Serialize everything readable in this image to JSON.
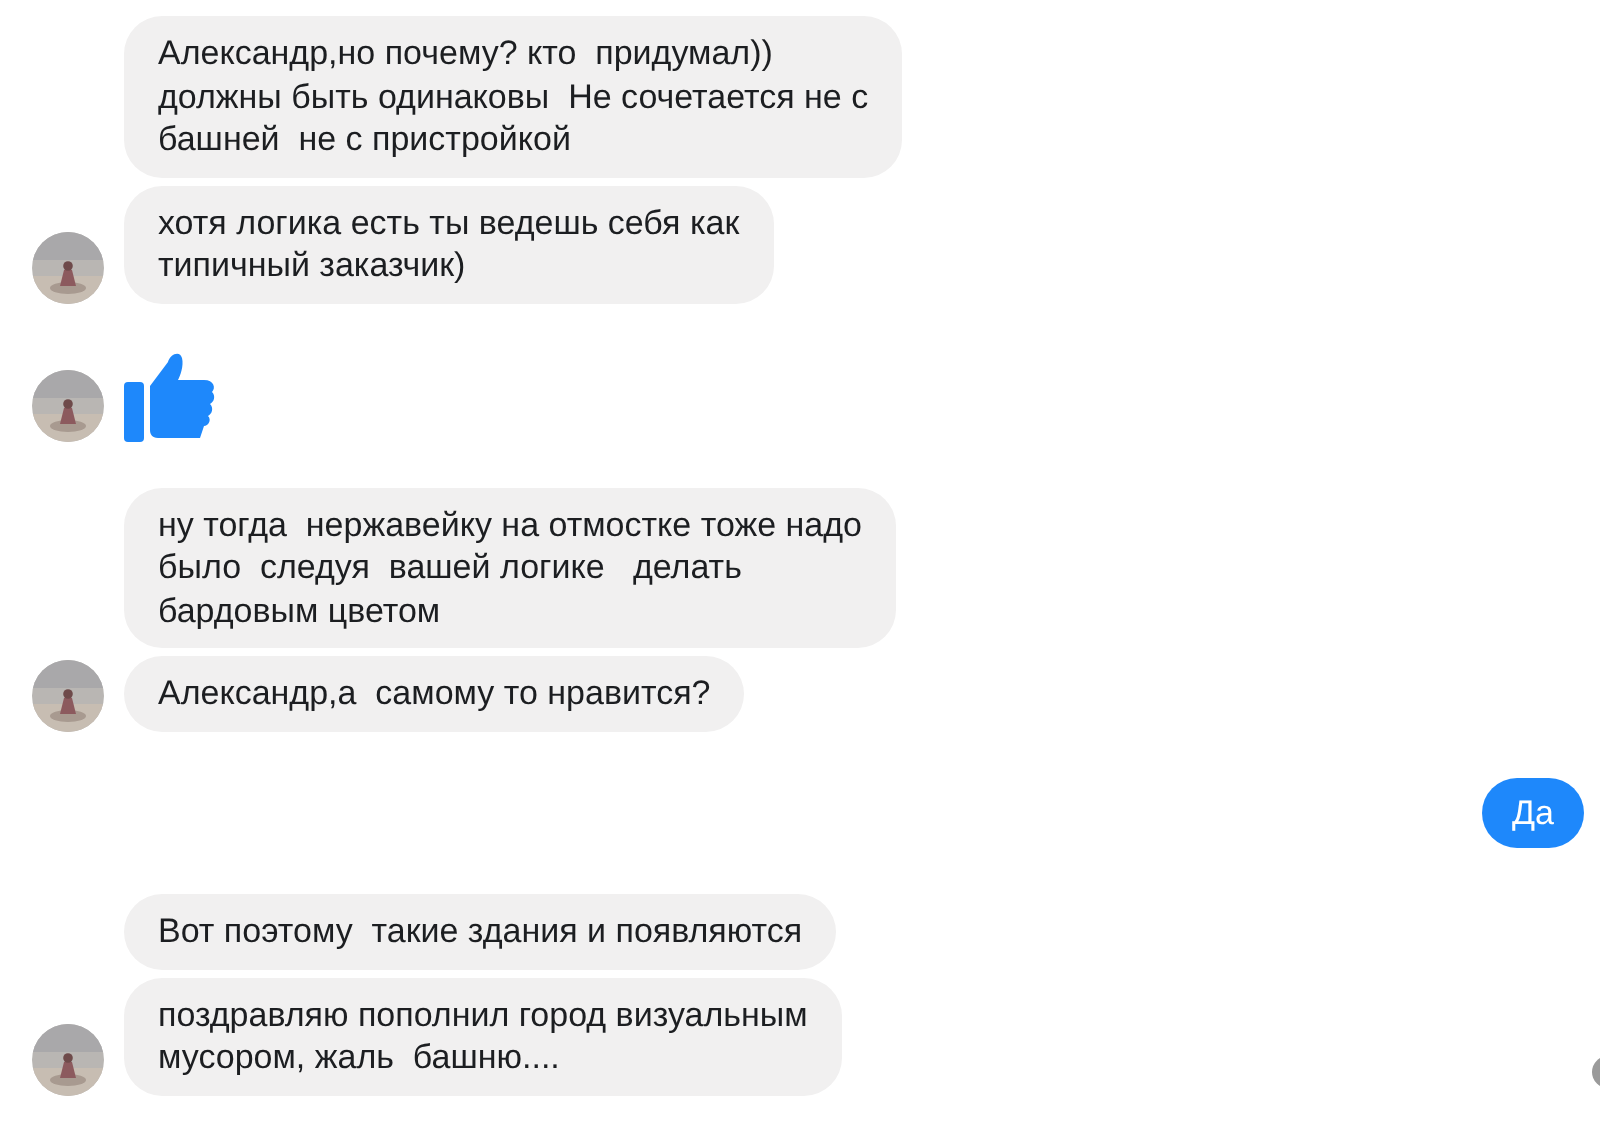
{
  "messages": [
    {
      "kind": "incoming",
      "seen": false,
      "bubbles": [
        {
          "kind": "text",
          "text": "Александр,но почему? кто  придумал))\nдолжны быть одинаковы  Не сочетается не с\nбашней  не с пристройкой"
        },
        {
          "kind": "text",
          "text": "хотя логика есть ты ведешь себя как\nтипичный заказчик)"
        }
      ]
    },
    {
      "kind": "incoming",
      "seen": false,
      "bubbles": [
        {
          "kind": "like"
        }
      ]
    },
    {
      "kind": "incoming",
      "seen": false,
      "bubbles": [
        {
          "kind": "text",
          "text": "ну тогда  нержавейку на отмостке тоже надо\nбыло  следуя  вашей логике   делать\nбардовым цветом"
        },
        {
          "kind": "text",
          "text": "Александр,а  самому то нравится?"
        }
      ]
    },
    {
      "kind": "outgoing",
      "seen": false,
      "bubbles": [
        {
          "kind": "text",
          "text": "Да"
        }
      ]
    },
    {
      "kind": "incoming",
      "seen": true,
      "bubbles": [
        {
          "kind": "text",
          "text": "Вот поэтому  такие здания и появляются"
        },
        {
          "kind": "text",
          "text": "поздравляю пополнил город визуальным\nмусором, жаль  башню...."
        }
      ]
    }
  ]
}
